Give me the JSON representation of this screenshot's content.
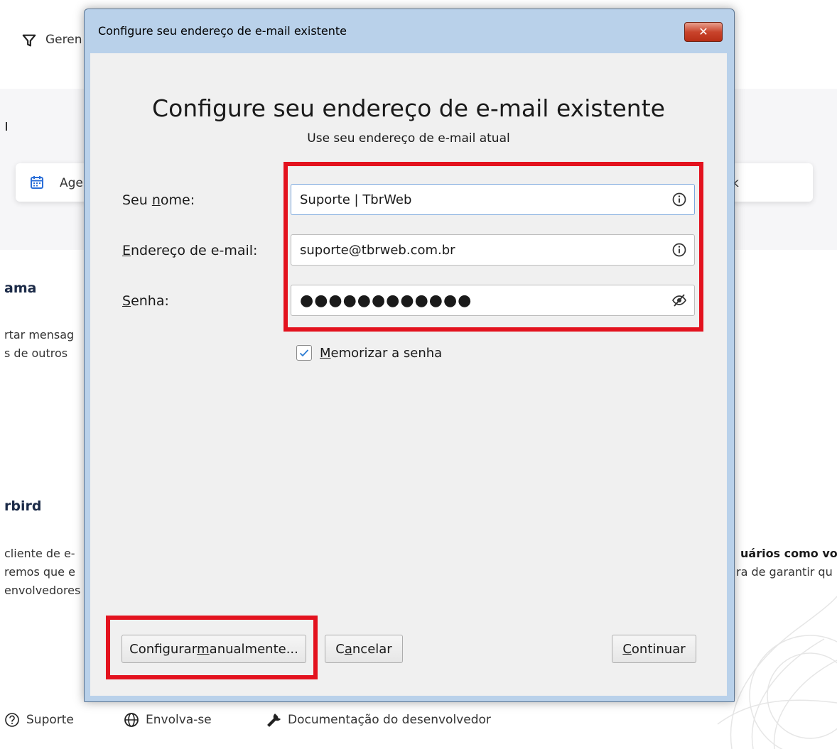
{
  "background": {
    "toolbar_label": "Geren",
    "card_label": "Age",
    "card_right_label": "k",
    "section1_heading": "ama",
    "section1_lines": [
      "rtar mensag",
      "s de outros"
    ],
    "section2_heading": "rbird",
    "section2_left_lines": [
      "cliente de e-",
      "remos que e",
      "envolvedores"
    ],
    "section2_right_lines": [
      "uários como voc",
      "ra de garantir qu"
    ],
    "footer": {
      "support": "Suporte",
      "engage": "Envolva-se",
      "dev_docs": "Documentação do desenvolvedor"
    }
  },
  "dialog": {
    "window_title": "Configure seu endereço de e-mail existente",
    "close_glyph": "✕",
    "heading": "Configure seu endereço de e-mail existente",
    "subheading": "Use seu endereço de e-mail atual",
    "fields": {
      "name": {
        "label_pre": "Seu ",
        "label_key": "n",
        "label_post": "ome:",
        "value": "Suporte | TbrWeb",
        "icon": "info-icon"
      },
      "email": {
        "label_pre": "",
        "label_key": "E",
        "label_post": "ndereço de e-mail:",
        "value": "suporte@tbrweb.com.br",
        "icon": "info-icon"
      },
      "password": {
        "label_pre": "",
        "label_key": "S",
        "label_post": "enha:",
        "value": "●●●●●●●●●●●●",
        "icon": "eye-slash-icon"
      }
    },
    "remember": {
      "label_key": "M",
      "label_post": "emorizar a senha",
      "checked": true
    },
    "buttons": {
      "manual": {
        "pre": "Configurar ",
        "key": "m",
        "post": "anualmente..."
      },
      "cancel": {
        "pre": "C",
        "key": "a",
        "post": "ncelar"
      },
      "continue": {
        "pre": "",
        "key": "C",
        "post": "ontinuar"
      }
    }
  },
  "colors": {
    "highlight": "#e3121e",
    "titlebar": "#b9d1ea",
    "client": "#f0f0f0",
    "close": "#c9442c",
    "check": "#2b7cd3"
  }
}
